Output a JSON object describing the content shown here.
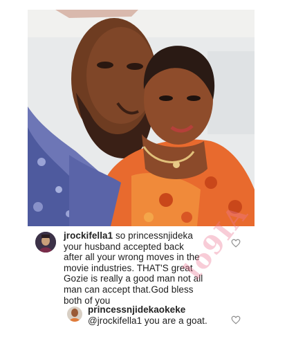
{
  "post": {
    "image_icon": "couple-selfie-photo"
  },
  "comments": [
    {
      "username": "jrockifella1",
      "lines": [
        " so princessnjideka",
        "your husband accepted back",
        "after all your wrong  moves in the",
        "movie industries. THAT'S great",
        "Gozie is really a good man not all",
        "man can accept that.God bless",
        "both of you"
      ],
      "like_icon": "heart-outline-icon"
    },
    {
      "username": "princessnjidekaokeke",
      "lines": [
        "@jrockifella1 you are a goat."
      ],
      "like_icon": "heart-outline-icon"
    }
  ],
  "watermark": "lo9IA",
  "colors": {
    "text": "#1d1d1d",
    "heart_outline": "#8e8e8e",
    "watermark": "#ec7896"
  }
}
